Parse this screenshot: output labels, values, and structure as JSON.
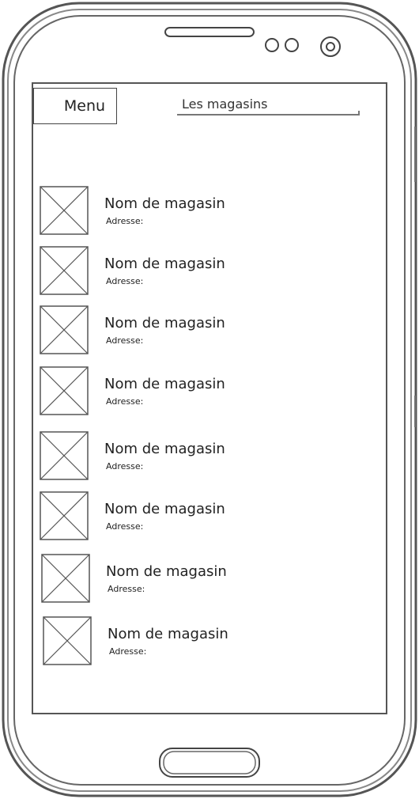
{
  "header": {
    "menu_label": "Menu",
    "title": "Les magasins"
  },
  "stores": [
    {
      "name": "Nom de magasin",
      "address_label": "Adresse:"
    },
    {
      "name": "Nom de magasin",
      "address_label": "Adresse:"
    },
    {
      "name": "Nom de magasin",
      "address_label": "Adresse:"
    },
    {
      "name": "Nom de magasin",
      "address_label": "Adresse:"
    },
    {
      "name": "Nom de magasin",
      "address_label": "Adresse:"
    },
    {
      "name": "Nom de magasin",
      "address_label": "Adresse:"
    },
    {
      "name": "Nom de magasin",
      "address_label": "Adresse:"
    },
    {
      "name": "Nom de magasin",
      "address_label": "Adresse:"
    }
  ],
  "icons": {
    "thumbnail": "image-placeholder-icon",
    "earpiece": "speaker-slot-icon",
    "sensor": "sensor-icon",
    "camera": "front-camera-icon",
    "home": "home-button-icon"
  }
}
